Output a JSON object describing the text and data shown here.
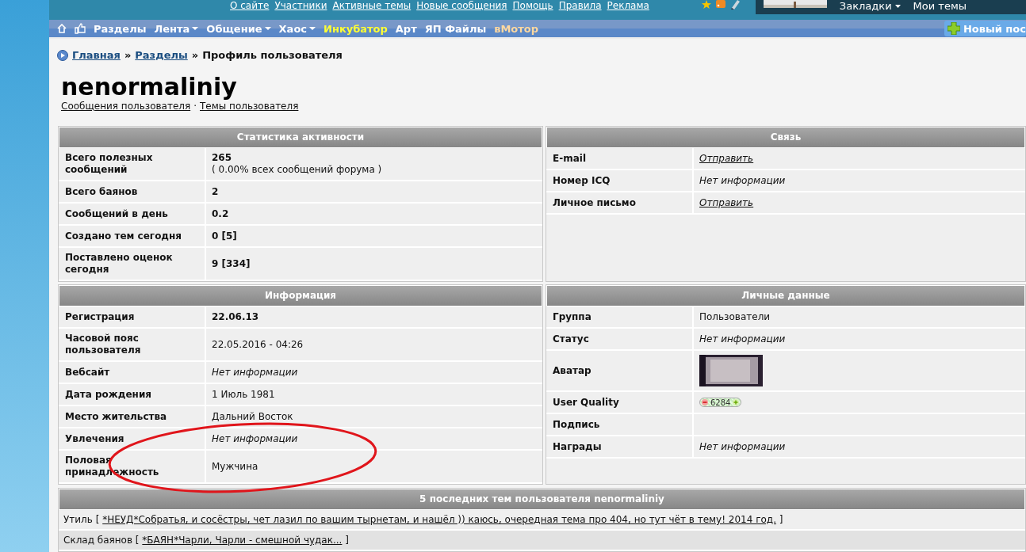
{
  "top_links": [
    "О сайте",
    "Участники",
    "Активные темы",
    "Новые сообщения",
    "Помощь",
    "Правила",
    "Реклама"
  ],
  "account_menu": [
    {
      "label": "Закладки",
      "dropdown": true
    },
    {
      "label": "Мои темы",
      "dropdown": false
    }
  ],
  "nav": {
    "items": [
      {
        "label": "Разделы",
        "dropdown": false,
        "color": "#ffffff"
      },
      {
        "label": "Лента",
        "dropdown": true,
        "color": "#ffffff"
      },
      {
        "label": "Общение",
        "dropdown": true,
        "color": "#ffffff"
      },
      {
        "label": "Хаос",
        "dropdown": true,
        "color": "#ffffff"
      },
      {
        "label": "Инкубатор",
        "dropdown": false,
        "color": "#ffff33"
      },
      {
        "label": "Арт",
        "dropdown": false,
        "color": "#ffffff"
      },
      {
        "label": "ЯП Файлы",
        "dropdown": false,
        "color": "#ffffff"
      },
      {
        "label": "вМотор",
        "dropdown": false,
        "color": "#ffd9a0"
      }
    ],
    "new_post": "Новый пос"
  },
  "breadcrumb": [
    {
      "label": "Главная",
      "kind": "link"
    },
    {
      "label": "»",
      "kind": "separator"
    },
    {
      "label": "Разделы",
      "kind": "link"
    },
    {
      "label": "»",
      "kind": "separator"
    },
    {
      "label": "Профиль пользователя",
      "kind": "current"
    }
  ],
  "username": "nenormaliniy",
  "user_links": [
    "Сообщения пользователя",
    "Темы пользователя"
  ],
  "user_links_separator": "·",
  "panels": [
    {
      "title": "Статистика активности",
      "rows": [
        {
          "label": "Всего полезных сообщений",
          "kind": "bold",
          "value": "265",
          "note": "( 0.00% всех сообщений форума )"
        },
        {
          "label": "Всего баянов",
          "kind": "bold",
          "value": "2"
        },
        {
          "label": "Сообщений в день",
          "kind": "bold",
          "value": "0.2"
        },
        {
          "label": "Создано тем сегодня",
          "kind": "bold",
          "value": "0 [5]"
        },
        {
          "label": "Поставлено оценок сегодня",
          "kind": "bold",
          "value": "9 [334]"
        }
      ]
    },
    {
      "title": "Связь",
      "rows": [
        {
          "label": "E-mail",
          "kind": "link",
          "value": "Отправить"
        },
        {
          "label": "Номер ICQ",
          "kind": "italic",
          "value": "Нет информации"
        },
        {
          "label": "Личное письмо",
          "kind": "link",
          "value": "Отправить"
        }
      ]
    },
    {
      "title": "Информация",
      "rows": [
        {
          "label": "Регистрация",
          "kind": "bold",
          "value": "22.06.13"
        },
        {
          "label": "Часовой пояс пользователя",
          "kind": "plain",
          "value": "22.05.2016 - 04:26"
        },
        {
          "label": "Вебсайт",
          "kind": "italic",
          "value": "Нет информации"
        },
        {
          "label": "Дата рождения",
          "kind": "plain",
          "value": "1 Июль 1981"
        },
        {
          "label": "Место жительства",
          "kind": "plain",
          "value": "Дальний Восток"
        },
        {
          "label": "Увлечения",
          "kind": "italic",
          "value": "Нет информации"
        },
        {
          "label": "Половая принадлежность",
          "kind": "plain",
          "value": "Мужчина"
        }
      ]
    },
    {
      "title": "Личные данные",
      "rows": [
        {
          "label": "Группа",
          "kind": "plain",
          "value": "Пользователи"
        },
        {
          "label": "Статус",
          "kind": "italic",
          "value": "Нет информации"
        },
        {
          "label": "Аватар",
          "kind": "picture"
        },
        {
          "label": "User Quality",
          "kind": "rating",
          "value": "6284"
        },
        {
          "label": "Подпись",
          "kind": "empty"
        },
        {
          "label": "Награды",
          "kind": "italic",
          "value": "Нет информации"
        }
      ]
    }
  ],
  "recent": {
    "title": "5 последних тем пользователя nenormaliniy",
    "rows": [
      {
        "section": "Утиль",
        "open": "[",
        "close": "]",
        "topic": "*НЕУД*Собратья, и сосёстры, чет лазил по вашим тырнетам, и нашёл )) каюсь, очередная тема про 404, но тут чёт в тему! 2014 год."
      },
      {
        "section": "Склад баянов",
        "open": "[",
        "close": "]",
        "topic": "*БАЯН*Чарли, Чарли - смешной чудак..."
      }
    ]
  }
}
